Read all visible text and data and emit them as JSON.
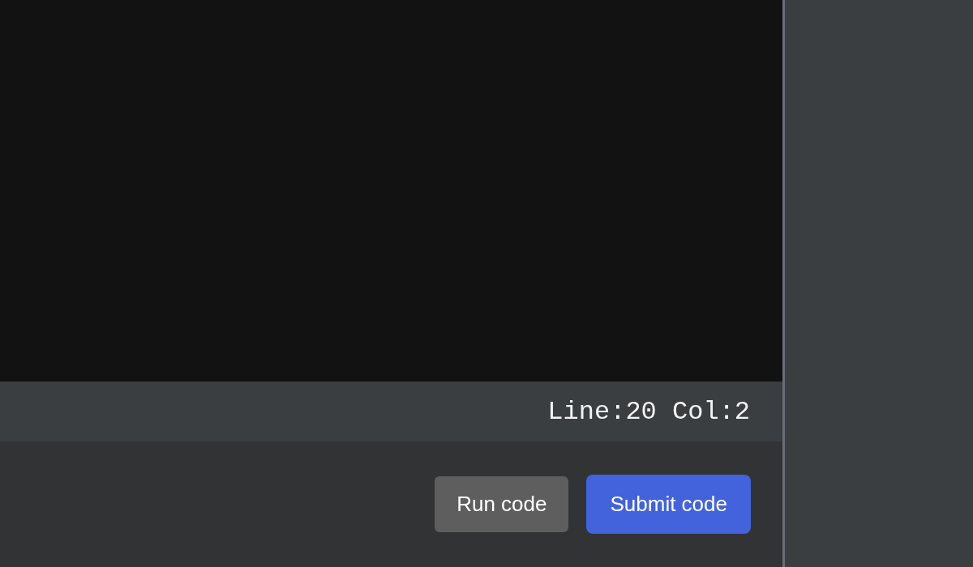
{
  "status_bar": {
    "cursor_position": "Line:20 Col:2"
  },
  "actions": [
    {
      "label": "Run code",
      "kind": "secondary"
    },
    {
      "label": "Submit code",
      "kind": "primary"
    }
  ]
}
